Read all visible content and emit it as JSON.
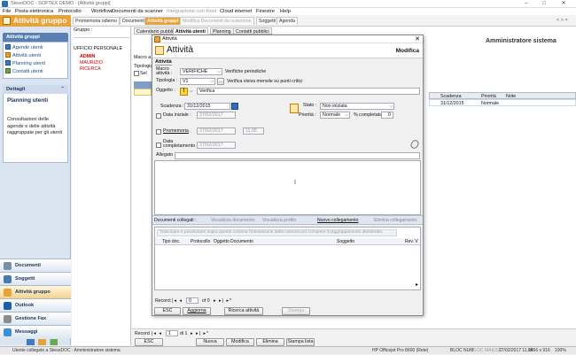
{
  "window": {
    "title": "StesoDOC - SOFTEX DEMO - [Attività gruppi]",
    "minimize": "–",
    "maximize": "□",
    "close": "✕"
  },
  "menu": [
    "File",
    "Posta elettronica",
    "Protocollo",
    "Workflow",
    "Documenti da scanner",
    "Integrazione con Host",
    "Cloud internet",
    "Finestre",
    "Help"
  ],
  "app_header": {
    "title": "Attività gruppo"
  },
  "tabs": [
    "Promemoria odierno",
    "Documenti",
    "Attività gruppi",
    "Modifica Documenti da scansione",
    "Soggetti",
    "Agenda"
  ],
  "tabs_right": "< > ×",
  "sidebar": {
    "section_title": "Attività gruppi",
    "items": [
      "Agende utenti",
      "Attività utenti",
      "Planning utenti",
      "Contatti utenti"
    ],
    "details_title": "Dettagli",
    "details_collapse": "⌃",
    "details_heading": "Planning utenti",
    "details_text": "Consultazioni delle agende e delle attività raggruppate per gli utenti",
    "nav": [
      "Documenti",
      "Soggetti",
      "Attività gruppo",
      "Outlook",
      "Gestione Fax",
      "Messaggi"
    ]
  },
  "gruppo": {
    "label": "Gruppo :",
    "root": "UFFICIO PERSONALE",
    "members": [
      "ADMIN",
      "MAURIZIO",
      "RICERCA"
    ]
  },
  "main": {
    "subtabs": [
      "Calendario pubblico",
      "Attività utenti",
      "Planning",
      "Contatti pubblici"
    ],
    "admin_label": "Amministratore sistema",
    "left_labels": {
      "macro": "Macro a",
      "tipologia": "Tipologia",
      "sel": "Sel"
    },
    "grid_header": [
      "Scadenza",
      "Priorità",
      "Note"
    ],
    "grid_row": [
      "31/12/2015",
      "Normale",
      ""
    ],
    "record_label": "Record",
    "record_value": "1",
    "record_of": "di 1",
    "buttons": [
      "ESC",
      "Nuova",
      "Modifica",
      "Elimina",
      "Stampa lista"
    ]
  },
  "dialog": {
    "title": "Attività",
    "close": "✕",
    "heading": "Attività",
    "mode": "Modifica",
    "section": "Attività",
    "macro_label": "Macro attività :",
    "macro_value": "VERIFICHE",
    "macro_desc": "Verifiche periodiche",
    "tipologia_label": "Tipologia :",
    "tipologia_value": "V1",
    "tipologia_ellipsis": "...",
    "tipologia_desc": "Verifica visiva mensile su punti critici",
    "oggetto_label": "Oggetto :",
    "oggetto_value": "Verifica",
    "scadenza_label": "Scadenza :",
    "scadenza_value": "31/12/2015",
    "stato_label": "Stato :",
    "stato_value": "Non iniziata",
    "data_iniziale_label": "Data iniziale :",
    "data_iniziale_value": "27/02/2017",
    "priorita_label": "Priorità :",
    "priorita_value": "Normale",
    "completata_label": "% completata",
    "completata_value": "0",
    "promemoria_label": "Promemoria",
    "promemoria_date": "27/02/2017",
    "promemoria_time": "11.05",
    "completamento_label": "Data completamento :",
    "completamento_value": "27/02/2017",
    "allegato_label": "Allegato :",
    "docs": {
      "title": "Documenti collegati :",
      "actions": [
        "Visualizza documento",
        "Visualizza profilo",
        "Nuovo collegamento",
        "Elimina collegamento"
      ],
      "hint": "Trascinare e posizionare sopra questa colonna l'intestazione della colonna per compiere il raggruppamento desiderato.",
      "columns": [
        "Tipo doc.",
        "Protocollo",
        "Oggetto Documento",
        "Soggetto",
        "Rev. V"
      ]
    },
    "record_label": "Record:",
    "record_value": "0",
    "record_of": "of 0",
    "buttons": [
      "ESC",
      "Aggiorna",
      "Ricerca attività",
      "Stampa"
    ]
  },
  "status": {
    "left": "Utente collegato a StesoDOC : Amministratore sistema",
    "printer": "HP Officejet Pro 8600 (Rete)",
    "caps": "BLOC NUM",
    "caps2": "BLOC MAIUSC",
    "datetime": "27/02/2017  11.06",
    "resolution": "1456 x 916",
    "zoom": "100%"
  }
}
